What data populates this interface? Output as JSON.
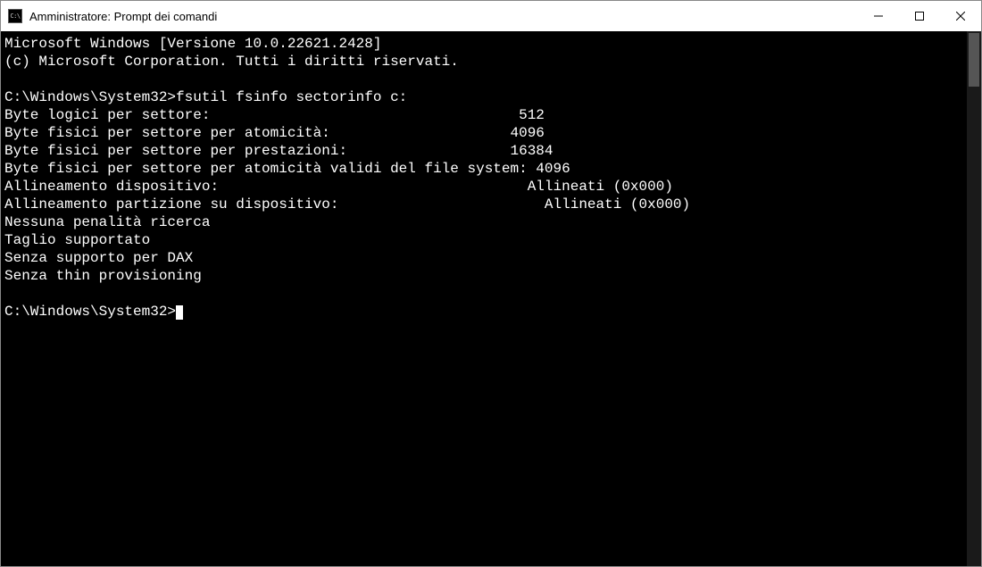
{
  "window": {
    "title": "Amministratore: Prompt dei comandi",
    "icon_label": "C:\\"
  },
  "terminal": {
    "header_line1": "Microsoft Windows [Versione 10.0.22621.2428]",
    "header_line2": "(c) Microsoft Corporation. Tutti i diritti riservati.",
    "prompt1": "C:\\Windows\\System32>",
    "command": "fsutil fsinfo sectorinfo c:",
    "lines": {
      "l1_label": "Byte logici per settore:",
      "l1_value": "512",
      "l2_label": "Byte fisici per settore per atomicità:",
      "l2_value": "4096",
      "l3_label": "Byte fisici per settore per prestazioni:",
      "l3_value": "16384",
      "l4_full": "Byte fisici per settore per atomicità validi del file system: 4096",
      "l5_label": "Allineamento dispositivo:",
      "l5_value": "Allineati (0x000)",
      "l6_label": "Allineamento partizione su dispositivo:",
      "l6_value": "Allineati (0x000)",
      "l7": "Nessuna penalità ricerca",
      "l8": "Taglio supportato",
      "l9": "Senza supporto per DAX",
      "l10": "Senza thin provisioning"
    },
    "prompt2": "C:\\Windows\\System32>"
  }
}
